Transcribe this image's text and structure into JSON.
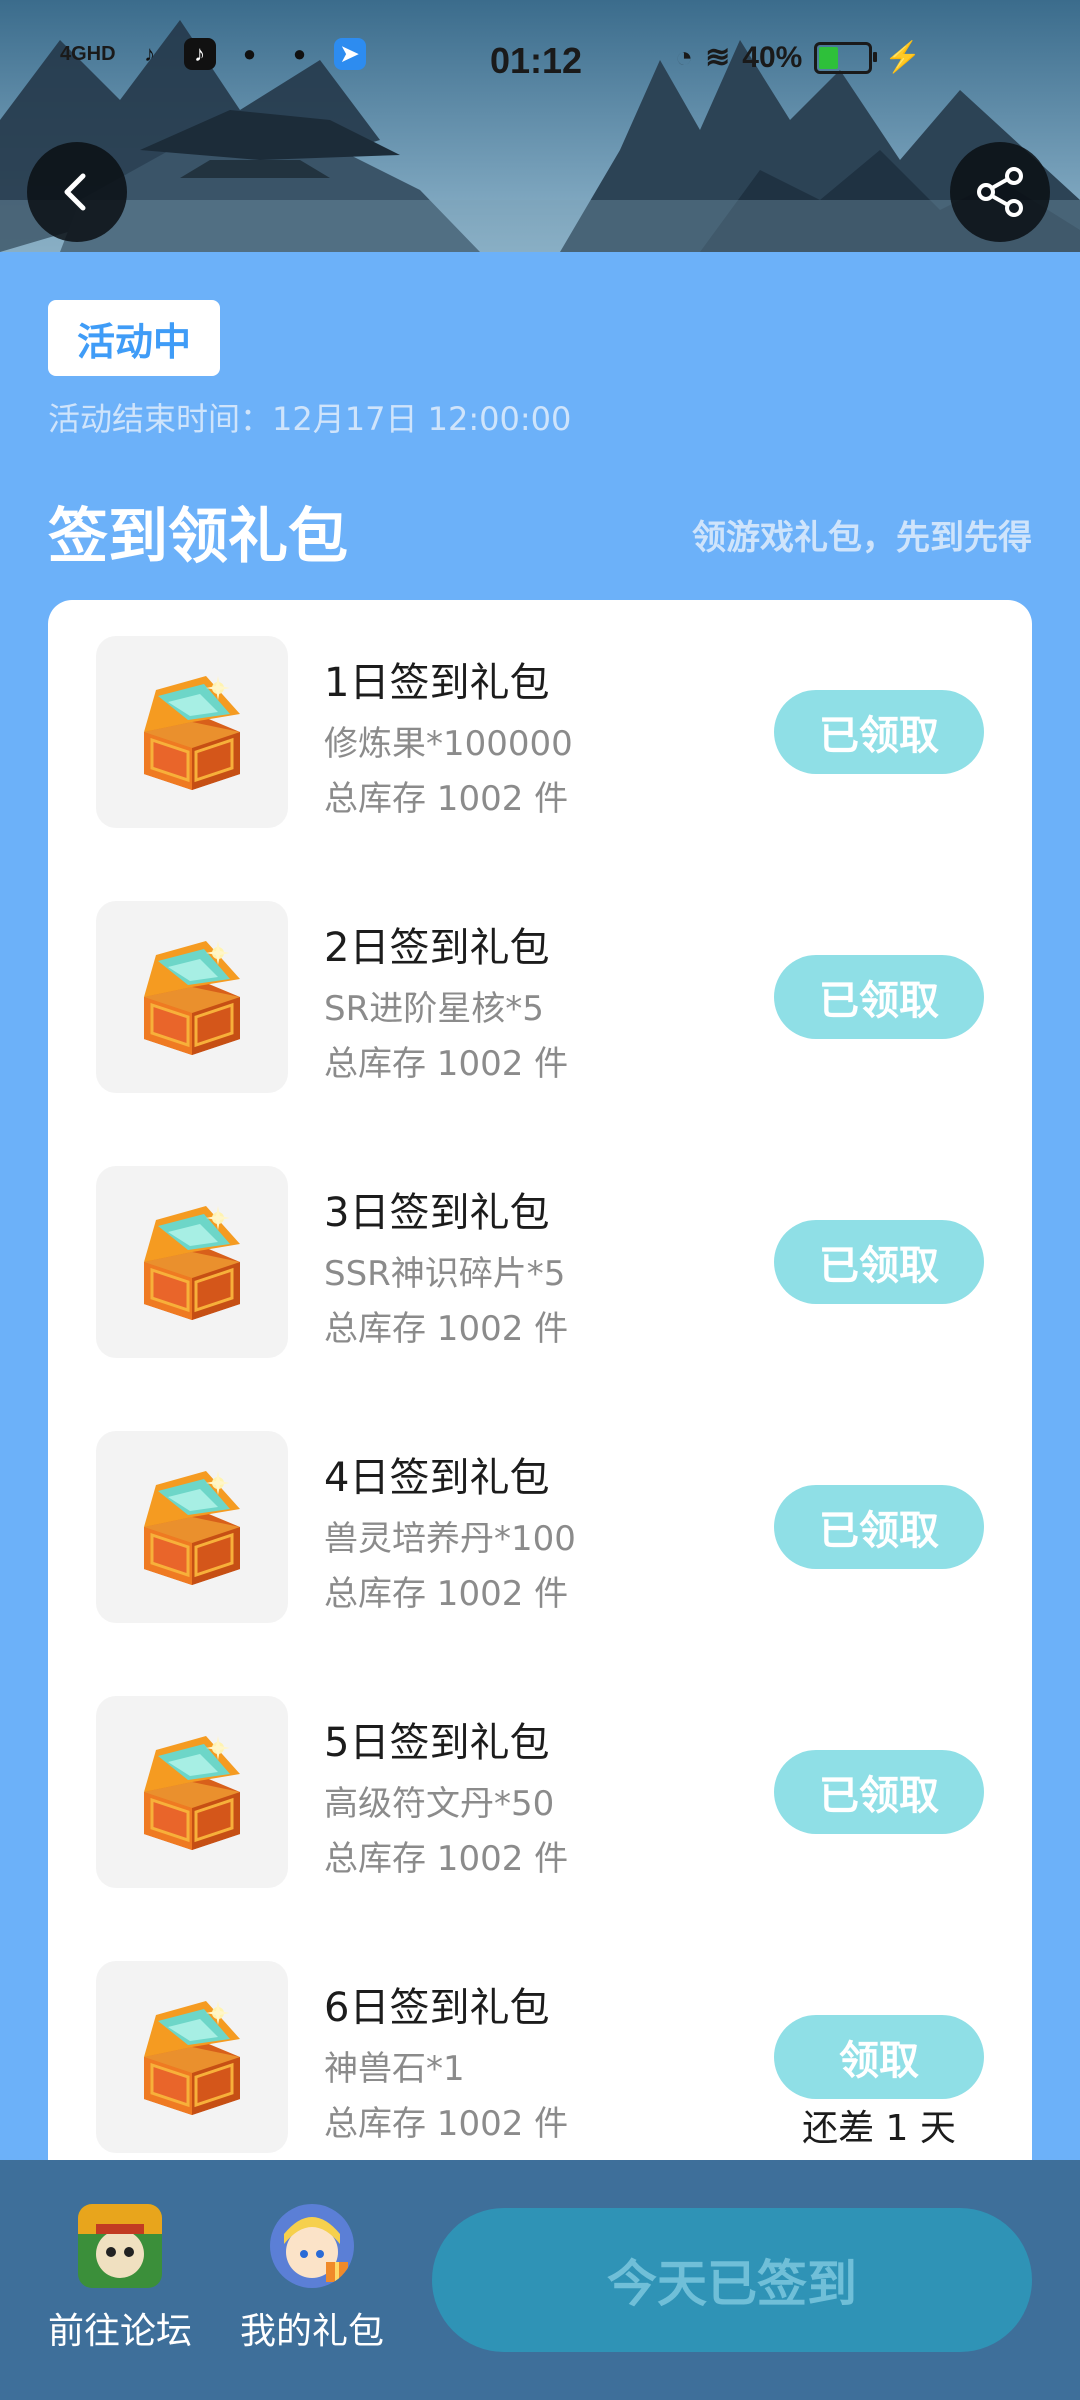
{
  "status_bar": {
    "network": "4GHD",
    "time": "01:12",
    "battery": "40%",
    "battery_level": 0.4
  },
  "header": {
    "back_icon": "chevron-left-icon",
    "share_icon": "share-icon"
  },
  "activity": {
    "status_badge": "活动中",
    "end_time": "活动结束时间：12月17日 12:00:00"
  },
  "section": {
    "title": "签到领礼包",
    "subtitle": "领游戏礼包，先到先得"
  },
  "gifts": [
    {
      "title": "1日签到礼包",
      "desc": "修炼果*100000",
      "stock": "总库存 1002 件",
      "button": "已领取",
      "note": ""
    },
    {
      "title": "2日签到礼包",
      "desc": "SR进阶星核*5",
      "stock": "总库存 1002 件",
      "button": "已领取",
      "note": ""
    },
    {
      "title": "3日签到礼包",
      "desc": "SSR神识碎片*5",
      "stock": "总库存 1002 件",
      "button": "已领取",
      "note": ""
    },
    {
      "title": "4日签到礼包",
      "desc": "兽灵培养丹*100",
      "stock": "总库存 1002 件",
      "button": "已领取",
      "note": ""
    },
    {
      "title": "5日签到礼包",
      "desc": "高级符文丹*50",
      "stock": "总库存 1002 件",
      "button": "已领取",
      "note": ""
    },
    {
      "title": "6日签到礼包",
      "desc": "神兽石*1",
      "stock": "总库存 1002 件",
      "button": "领取",
      "note": "还差 1 天"
    }
  ],
  "bottom_bar": {
    "forum_label": "前往论坛",
    "my_gifts_label": "我的礼包",
    "signed_button": "今天已签到"
  },
  "colors": {
    "page_bg": "#6cb1f9",
    "button_disabled": "#8fdfe6",
    "bottom_bar": "#3e6f9a",
    "signed_button": "#2f93b6"
  }
}
